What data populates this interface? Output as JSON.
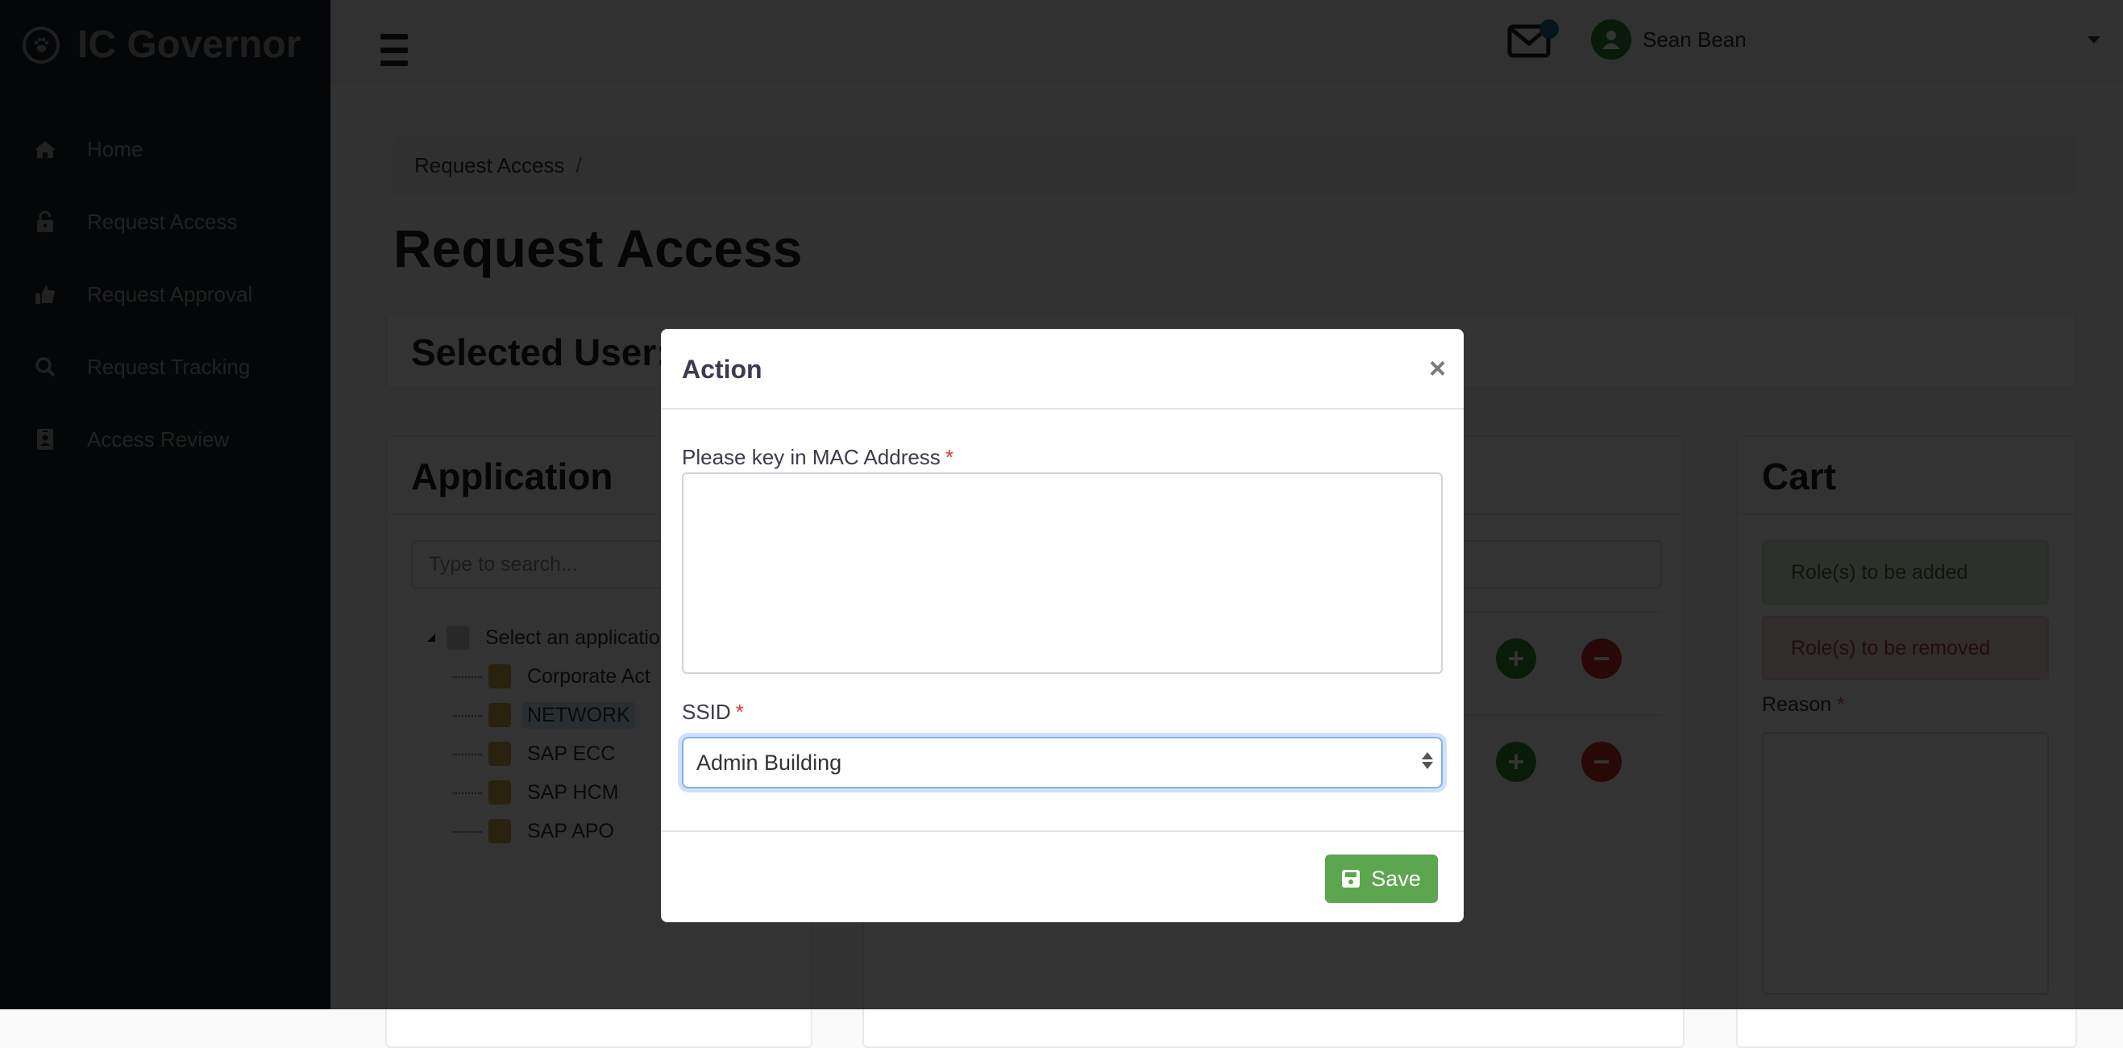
{
  "app": {
    "name": "IC Governor",
    "logo_icon": "paw-icon"
  },
  "sidebar": {
    "items": [
      {
        "label": "Home",
        "icon": "home-icon"
      },
      {
        "label": "Request Access",
        "icon": "unlock-icon"
      },
      {
        "label": "Request Approval",
        "icon": "thumbs-up-icon"
      },
      {
        "label": "Request Tracking",
        "icon": "search-icon"
      },
      {
        "label": "Access Review",
        "icon": "id-badge-icon"
      }
    ]
  },
  "topbar": {
    "user_name": "Sean Bean",
    "notification_icon": "envelope-icon"
  },
  "breadcrumb": {
    "items": [
      "Request Access"
    ],
    "separator": "/"
  },
  "page": {
    "title": "Request Access",
    "selected_user_label": "Selected User:"
  },
  "application_panel": {
    "title": "Application",
    "search_placeholder": "Type to search...",
    "tree": {
      "root": "Select an application",
      "children": [
        "Corporate Act",
        "NETWORK",
        "SAP ECC",
        "SAP HCM",
        "SAP APO"
      ],
      "selected": "NETWORK"
    }
  },
  "cart": {
    "title": "Cart",
    "added_label": "Role(s) to be added",
    "removed_label": "Role(s) to be removed",
    "reason_label": "Reason",
    "required_mark": "*"
  },
  "modal": {
    "title": "Action",
    "close_symbol": "×",
    "mac_label": "Please key in MAC Address",
    "mac_value": "",
    "ssid_label": "SSID",
    "ssid_value": "Admin Building",
    "required_mark": "*",
    "save_label": "Save"
  },
  "colors": {
    "save_button": "#5ca64f",
    "required": "#d33333",
    "focus_ring": "#80b3f0",
    "add_button": "#2e8b2e",
    "remove_button": "#c9302c"
  }
}
